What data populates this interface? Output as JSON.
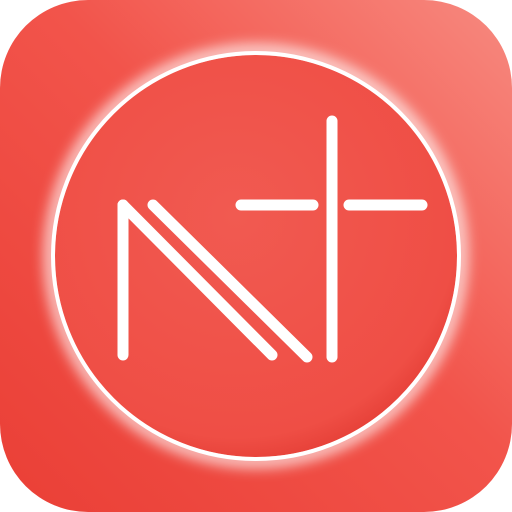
{
  "icon": {
    "name": "N+ app icon",
    "glyph": "N+",
    "colors": {
      "background_light": "#f78a80",
      "background": "#f2544b",
      "background_dark": "#ea3f36",
      "badge": "#f15a51",
      "badge_edge": "#e23a32",
      "ring": "#ffffff",
      "stroke": "#ffffff"
    }
  }
}
